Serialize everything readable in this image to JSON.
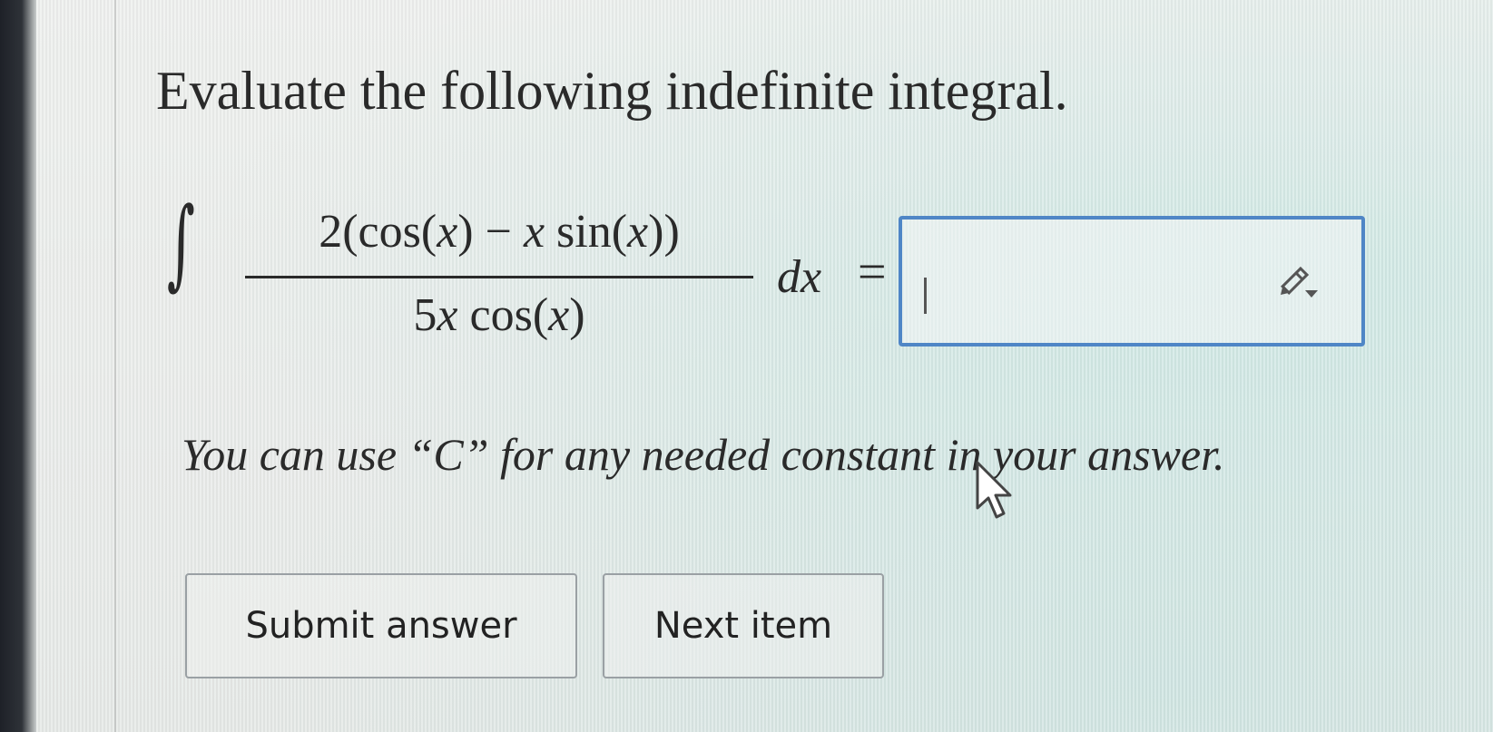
{
  "question": {
    "heading": "Evaluate the following indefinite integral.",
    "integral": {
      "sign": "∫",
      "numerator": {
        "part1": "2(cos(",
        "var1": "x",
        "part2": ") − ",
        "var2": "x",
        "part3": " sin(",
        "var3": "x",
        "part4": "))"
      },
      "denominator": {
        "part1": "5",
        "var1": "x",
        "part2": " cos(",
        "var2": "x",
        "part3": ")"
      },
      "differential": "dx",
      "equals": "="
    },
    "answer": {
      "value": "",
      "editor_icon": "pencil-dropdown-icon",
      "accent_color": "#4f86c6"
    },
    "hint": "You can use “C” for any needed constant in your answer."
  },
  "actions": {
    "submit_label": "Submit answer",
    "next_label": "Next item"
  },
  "cursor": {
    "icon": "arrow-cursor-icon"
  }
}
